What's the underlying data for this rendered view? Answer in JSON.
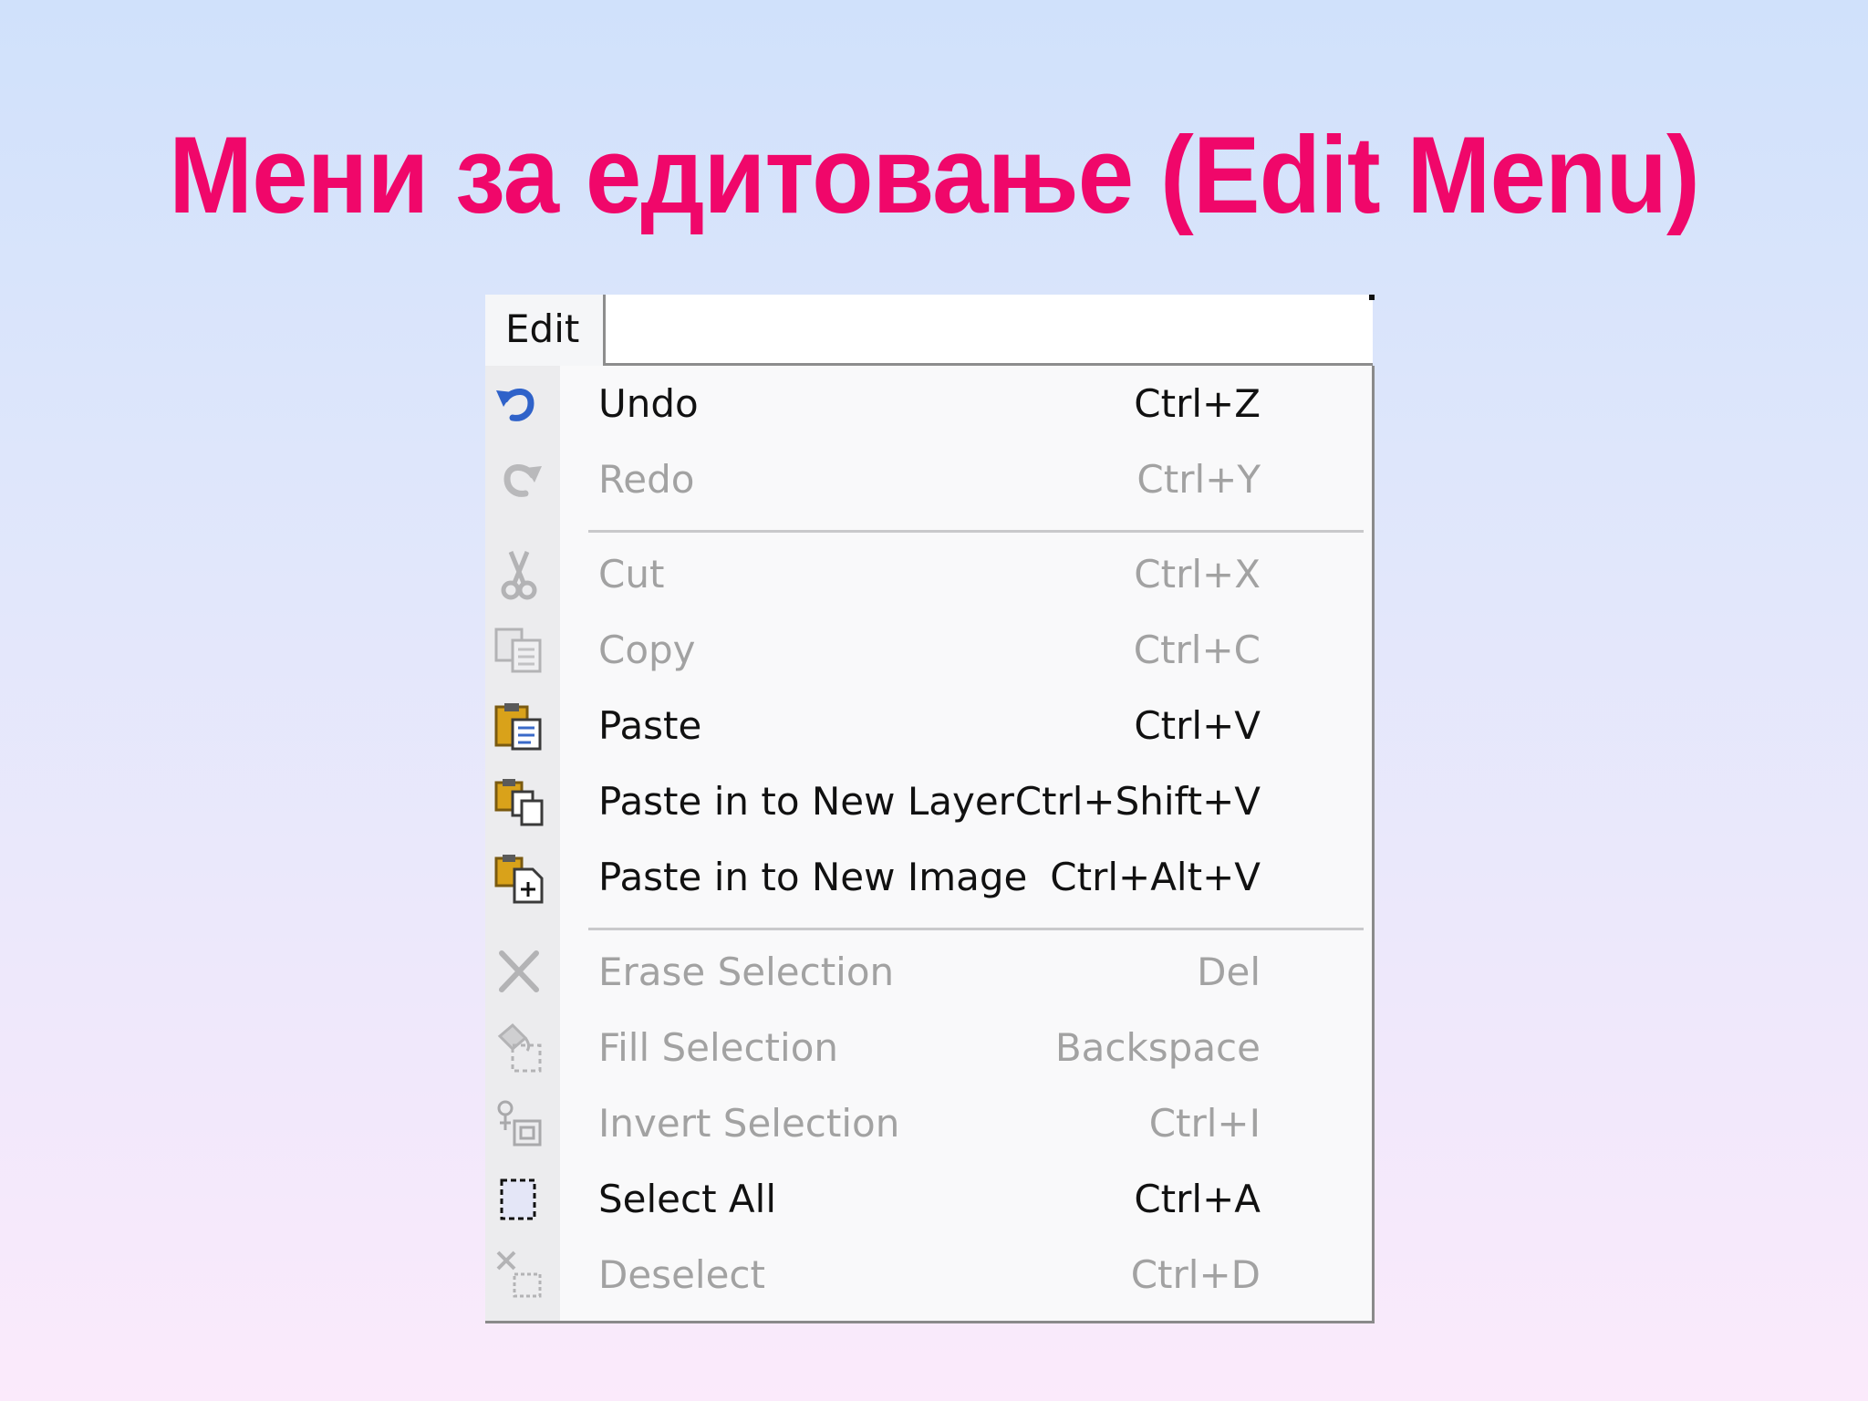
{
  "slide": {
    "title": "Мени за едитовање (Edit Menu)"
  },
  "menubar": {
    "edit_label": "Edit"
  },
  "menu": {
    "items": [
      {
        "label": "Undo",
        "shortcut": "Ctrl+Z",
        "enabled": true,
        "icon": "undo-icon"
      },
      {
        "label": "Redo",
        "shortcut": "Ctrl+Y",
        "enabled": false,
        "icon": "redo-icon"
      },
      {
        "label": "Cut",
        "shortcut": "Ctrl+X",
        "enabled": false,
        "icon": "scissors-icon"
      },
      {
        "label": "Copy",
        "shortcut": "Ctrl+C",
        "enabled": false,
        "icon": "copy-icon"
      },
      {
        "label": "Paste",
        "shortcut": "Ctrl+V",
        "enabled": true,
        "icon": "paste-icon"
      },
      {
        "label": "Paste in to New Layer",
        "shortcut": "Ctrl+Shift+V",
        "enabled": true,
        "icon": "paste-new-layer-icon"
      },
      {
        "label": "Paste in to New Image",
        "shortcut": "Ctrl+Alt+V",
        "enabled": true,
        "icon": "paste-new-image-icon"
      },
      {
        "label": "Erase Selection",
        "shortcut": "Del",
        "enabled": false,
        "icon": "erase-selection-icon"
      },
      {
        "label": "Fill Selection",
        "shortcut": "Backspace",
        "enabled": false,
        "icon": "fill-selection-icon"
      },
      {
        "label": "Invert Selection",
        "shortcut": "Ctrl+I",
        "enabled": false,
        "icon": "invert-selection-icon"
      },
      {
        "label": "Select All",
        "shortcut": "Ctrl+A",
        "enabled": true,
        "icon": "select-all-icon"
      },
      {
        "label": "Deselect",
        "shortcut": "Ctrl+D",
        "enabled": false,
        "icon": "deselect-icon"
      }
    ]
  },
  "colors": {
    "title": "#f0076a",
    "enabled_text": "#111111",
    "disabled_text": "#a2a2a2",
    "undo_blue": "#2f62c9",
    "clipboard_gold": "#d9a21a"
  }
}
